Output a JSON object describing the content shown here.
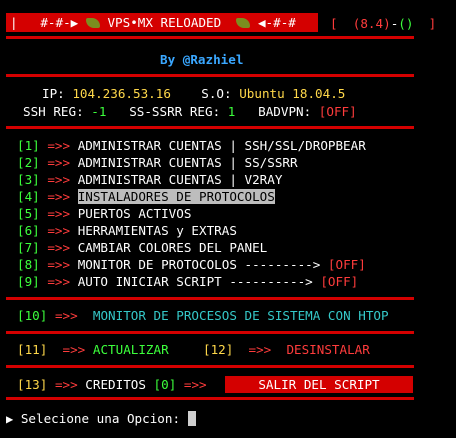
{
  "header": {
    "left_bracket": "|",
    "title": "#-#-▶  VPS•MX RELOADED  ◀-#-#",
    "title_left": "#-#-▶",
    "title_main": "VPS•MX RELOADED",
    "title_right": "◀-#-#",
    "version_open": "[",
    "version": "(8.4)",
    "version_dash": "-",
    "version_paren": "()",
    "version_close": "]",
    "author": "By @Razhiel"
  },
  "info": {
    "ip_label": "IP:",
    "ip_value": "104.236.53.16",
    "so_label": "S.O:",
    "so_value": "Ubuntu 18.04.5",
    "ssh_label": "SSH REG:",
    "ssh_value": "-1",
    "ssrr_label": "SS-SSRR REG:",
    "ssrr_value": "1",
    "badvpn_label": "BADVPN:",
    "badvpn_value": "[OFF]"
  },
  "menu": [
    {
      "num": "[1]",
      "arrow": "=>>",
      "label": "ADMINISTRAR CUENTAS | SSH/SSL/DROPBEAR",
      "status": ""
    },
    {
      "num": "[2]",
      "arrow": "=>>",
      "label": "ADMINISTRAR CUENTAS | SS/SSRR",
      "status": ""
    },
    {
      "num": "[3]",
      "arrow": "=>>",
      "label": "ADMINISTRAR CUENTAS | V2RAY",
      "status": ""
    },
    {
      "num": "[4]",
      "arrow": "=>>",
      "label": "INSTALADORES DE PROTOCOLOS",
      "status": ""
    },
    {
      "num": "[5]",
      "arrow": "=>>",
      "label": "PUERTOS ACTIVOS",
      "status": ""
    },
    {
      "num": "[6]",
      "arrow": "=>>",
      "label": "HERRAMIENTAS y EXTRAS",
      "status": ""
    },
    {
      "num": "[7]",
      "arrow": "=>>",
      "label": "CAMBIAR COLORES DEL PANEL",
      "status": ""
    },
    {
      "num": "[8]",
      "arrow": "=>>",
      "label": "MONITOR DE PROTOCOLOS --------->",
      "status": "[OFF]"
    },
    {
      "num": "[9]",
      "arrow": "=>>",
      "label": "AUTO INICIAR SCRIPT ---------->",
      "status": "[OFF]"
    }
  ],
  "opt10": {
    "num": "[10]",
    "arrow": "=>>",
    "label": "MONITOR DE PROCESOS DE SISTEMA CON HTOP"
  },
  "opt11": {
    "num": "[11]",
    "arrow": "=>>",
    "label": "ACTUALIZAR"
  },
  "opt12": {
    "num": "[12]",
    "arrow": "=>>",
    "label": "DESINSTALAR"
  },
  "opt13": {
    "num": "[13]",
    "arrow": "=>>",
    "label": "CREDITOS"
  },
  "opt0": {
    "num": "[0]",
    "arrow": "=>>",
    "label": "SALIR DEL SCRIPT"
  },
  "prompt": {
    "arrow": "▶",
    "text": "Selecione una Opcion:"
  },
  "colors": {
    "accent": "#d40000",
    "yellow": "#ffd84a",
    "green": "#3cff3c",
    "red": "#ff3c3c",
    "blue": "#3aa7ff",
    "cyan": "#35c8c8"
  }
}
